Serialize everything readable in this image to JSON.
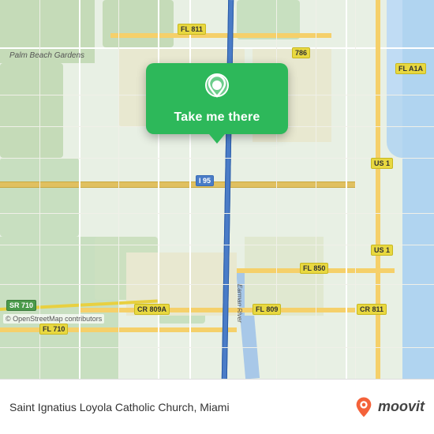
{
  "map": {
    "attribution": "© OpenStreetMap contributors",
    "region": "Palm Beach Gardens, Miami"
  },
  "popup": {
    "button_label": "Take me there",
    "pin_icon": "location-pin"
  },
  "bottom_bar": {
    "destination": "Saint Ignatius Loyola Catholic Church, Miami",
    "logo_text": "moovit"
  },
  "road_labels": [
    {
      "id": "fl811",
      "text": "FL 811",
      "style": "yellow"
    },
    {
      "id": "fl786",
      "text": "786",
      "style": "yellow"
    },
    {
      "id": "fl1a",
      "text": "FL A1A",
      "style": "yellow"
    },
    {
      "id": "us1a",
      "text": "US 1",
      "style": "yellow"
    },
    {
      "id": "us1b",
      "text": "US 1",
      "style": "yellow"
    },
    {
      "id": "i95",
      "text": "I 95",
      "style": "blue"
    },
    {
      "id": "cr809a",
      "text": "CR 809A",
      "style": "yellow"
    },
    {
      "id": "fl850",
      "text": "FL 850",
      "style": "yellow"
    },
    {
      "id": "fl809",
      "text": "FL 809",
      "style": "yellow"
    },
    {
      "id": "cr811",
      "text": "CR 811",
      "style": "yellow"
    },
    {
      "id": "sr710",
      "text": "SR 710",
      "style": "green"
    },
    {
      "id": "fl710",
      "text": "FL 710",
      "style": "yellow"
    }
  ],
  "map_labels": [
    {
      "id": "pbg",
      "text": "Palm Beach Gardens"
    },
    {
      "id": "earman",
      "text": "Earman River"
    }
  ]
}
